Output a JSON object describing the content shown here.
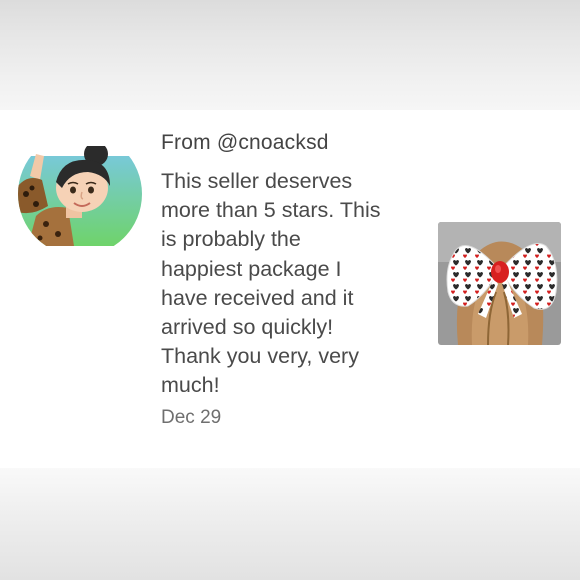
{
  "review": {
    "from_label": "From @cnoacksd",
    "message": "This seller deserves\nmore than 5 stars. This\nis probably the\nhappiest package I\nhave received and it\narrived so quickly!\nThank you very, very\nmuch!",
    "date": "Dec 29"
  },
  "avatar": {
    "icon": "avatar-bitmoji-icon"
  },
  "photo": {
    "icon": "hair-bow-photo"
  },
  "colors": {
    "text_primary": "#444444",
    "text_secondary": "#6f6f6f",
    "background": "#ffffff"
  }
}
